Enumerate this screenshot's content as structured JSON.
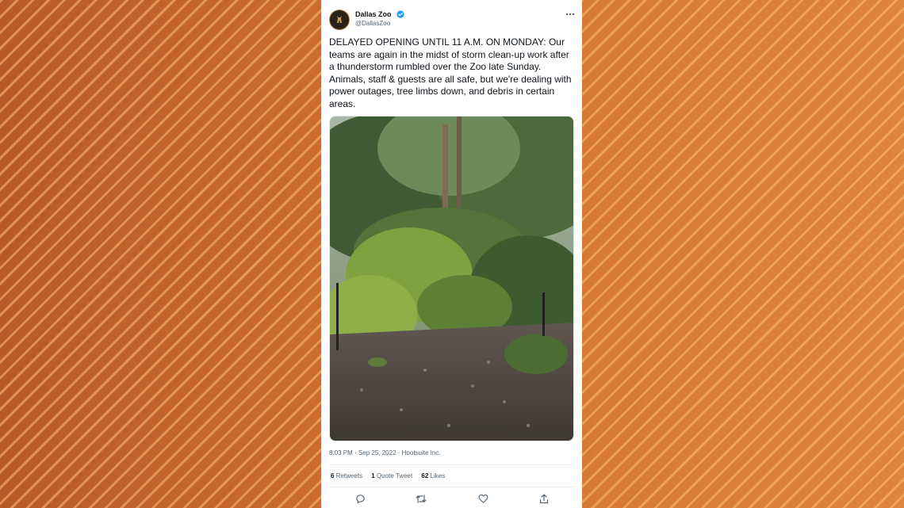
{
  "tweet": {
    "display_name": "Dallas Zoo",
    "handle": "@DallasZoo",
    "verified": true,
    "text": "DELAYED OPENING UNTIL 11 A.M. ON MONDAY: Our teams are again in the midst of storm clean-up work after a thunderstorm rumbled over the Zoo late Sunday. Animals, staff & guests are all safe, but we're dealing with power outages, tree limbs down, and debris in certain areas.",
    "time": "8:03 PM",
    "date": "Sep 25, 2022",
    "source": "Hootsuite Inc.",
    "retweets_count": "6",
    "retweets_label": "Retweets",
    "quotes_count": "1",
    "quotes_label": "Quote Tweet",
    "likes_count": "62",
    "likes_label": "Likes"
  },
  "icons": {
    "more": "more-icon",
    "reply": "reply-icon",
    "retweet": "retweet-icon",
    "like": "like-icon",
    "share": "share-icon",
    "verified": "verified-badge-icon"
  },
  "colors": {
    "verified": "#1d9bf0",
    "text": "#0f1419",
    "secondary": "#536471",
    "background_orange": "#c8692f"
  }
}
